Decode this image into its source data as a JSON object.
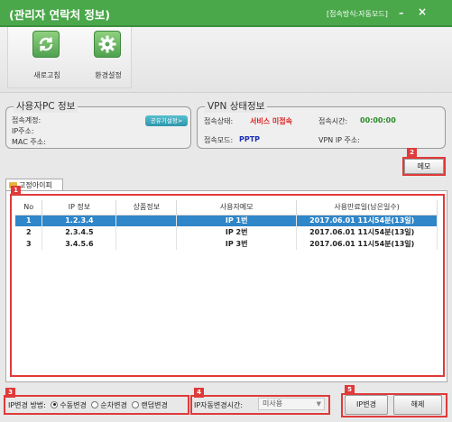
{
  "titlebar": {
    "title": "(관리자 연락처 정보)",
    "mode": "[접속방식:자동모드]",
    "minimize": "–",
    "close": "×"
  },
  "toolbar": {
    "refresh": {
      "label": "새로고침",
      "icon": "refresh-icon"
    },
    "settings": {
      "label": "환경설정",
      "icon": "gear-icon"
    }
  },
  "pc_info": {
    "legend": "사용자PC 정보",
    "account_label": "접속계정:",
    "ip_label": "IP주소:",
    "mac_label": "MAC 주소:",
    "share_button": "공유기설정>"
  },
  "vpn_info": {
    "legend": "VPN 상태정보",
    "status_label": "접속상태:",
    "status_value": "서비스 미접속",
    "time_label": "접속시간:",
    "time_value": "00:00:00",
    "mode_label": "접속모드:",
    "mode_value": "PPTP",
    "vpnip_label": "VPN IP 주소:"
  },
  "badges": {
    "b1": "1",
    "b2": "2",
    "b3": "3",
    "b4": "4",
    "b5": "5"
  },
  "memo_button": "메모",
  "tab": {
    "label": "고정아이피"
  },
  "table": {
    "headers": [
      "No",
      "IP 정보",
      "상품정보",
      "사용자메모",
      "사용만료일(남은일수)"
    ],
    "rows": [
      {
        "no": "1",
        "ip": "1.2.3.4",
        "product": "",
        "memo": "IP 1번",
        "expiry": "2017.06.01 11시54분(13일)",
        "selected": true
      },
      {
        "no": "2",
        "ip": "2.3.4.5",
        "product": "",
        "memo": "IP 2번",
        "expiry": "2017.06.01 11시54분(13일)",
        "selected": false
      },
      {
        "no": "3",
        "ip": "3.4.5.6",
        "product": "",
        "memo": "IP 3번",
        "expiry": "2017.06.01 11시54분(13일)",
        "selected": false
      }
    ]
  },
  "change_method": {
    "label": "IP변경 방법:",
    "options": [
      "수동변경",
      "순차변경",
      "랜덤변경"
    ],
    "selected": "수동변경"
  },
  "auto_change": {
    "label": "IP자동변경시간:",
    "value": "미사용"
  },
  "buttons": {
    "change_ip": "IP변경",
    "release": "해제"
  },
  "colors": {
    "titlebar": "#4aa84a",
    "highlight": "#e03a3a",
    "selection": "#2f86c8"
  }
}
